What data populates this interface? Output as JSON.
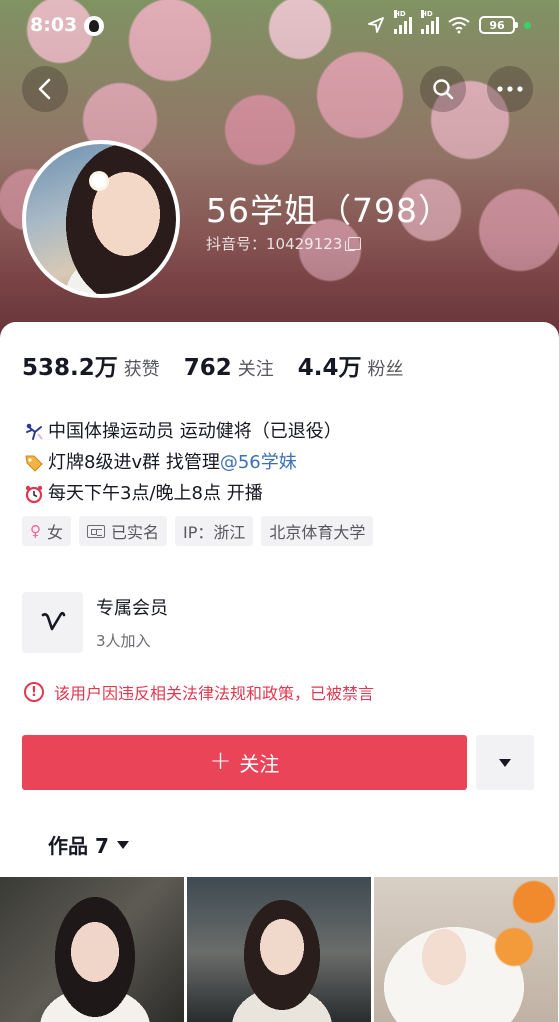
{
  "status_bar": {
    "time": "8:03",
    "battery": "96",
    "signal_labels": [
      "HD",
      "HD"
    ]
  },
  "nav": {
    "back_icon": "chevron-left-icon",
    "search_icon": "search-icon",
    "more_icon": "more-horizontal-icon"
  },
  "profile": {
    "name": "56学姐（798）",
    "douyin_id": "抖音号：10429123"
  },
  "stats": [
    {
      "value": "538.2万",
      "label": "获赞"
    },
    {
      "value": "762",
      "label": "关注"
    },
    {
      "value": "4.4万",
      "label": "粉丝"
    }
  ],
  "bio": {
    "line1": "中国体操运动员 运动健将（已退役）",
    "line2_prefix": "灯牌8级进v群 找管理",
    "line2_mention": "@56学妹",
    "line3": "每天下午3点/晚上8点 开播"
  },
  "tags": {
    "gender": "女",
    "verified": "已实名",
    "ip": "IP：浙江",
    "school": "北京体育大学"
  },
  "membership": {
    "title": "专属会员",
    "subtitle": "3人加入"
  },
  "ban_notice": "该用户因违反相关法律法规和政策，已被禁言",
  "actions": {
    "follow_label": "关注"
  },
  "works": {
    "tab_label": "作品 7"
  },
  "colors": {
    "primary": "#ea4458",
    "mention": "#3b6fb6",
    "warning": "#e0384f"
  }
}
